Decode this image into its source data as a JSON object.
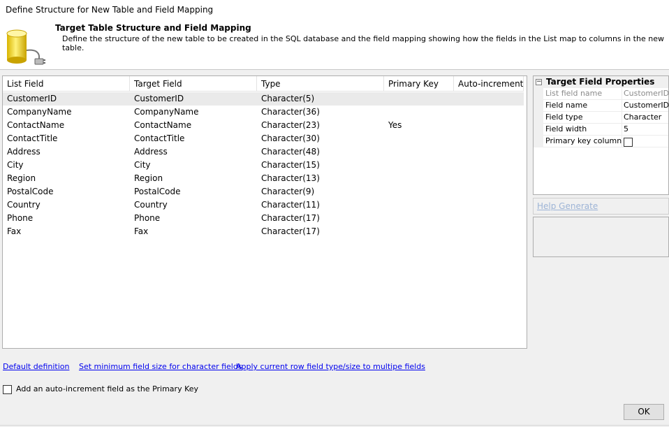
{
  "window": {
    "title": "Define Structure for New Table and Field Mapping"
  },
  "header": {
    "title": "Target Table Structure and Field Mapping",
    "description": "Define the structure of the new table to be created in the SQL database and the field mapping showing how the fields in the List map to columns in the new table."
  },
  "grid": {
    "columns": [
      "List Field",
      "Target Field",
      "Type",
      "Primary Key",
      "Auto-increment"
    ],
    "rows": [
      {
        "list_field": "CustomerID",
        "target_field": "CustomerID",
        "type": "Character(5)",
        "primary_key": "",
        "auto_increment": ""
      },
      {
        "list_field": "CompanyName",
        "target_field": "CompanyName",
        "type": "Character(36)",
        "primary_key": "",
        "auto_increment": ""
      },
      {
        "list_field": "ContactName",
        "target_field": "ContactName",
        "type": "Character(23)",
        "primary_key": "Yes",
        "auto_increment": ""
      },
      {
        "list_field": "ContactTitle",
        "target_field": "ContactTitle",
        "type": "Character(30)",
        "primary_key": "",
        "auto_increment": ""
      },
      {
        "list_field": "Address",
        "target_field": "Address",
        "type": "Character(48)",
        "primary_key": "",
        "auto_increment": ""
      },
      {
        "list_field": "City",
        "target_field": "City",
        "type": "Character(15)",
        "primary_key": "",
        "auto_increment": ""
      },
      {
        "list_field": "Region",
        "target_field": "Region",
        "type": "Character(13)",
        "primary_key": "",
        "auto_increment": ""
      },
      {
        "list_field": "PostalCode",
        "target_field": "PostalCode",
        "type": "Character(9)",
        "primary_key": "",
        "auto_increment": ""
      },
      {
        "list_field": "Country",
        "target_field": "Country",
        "type": "Character(11)",
        "primary_key": "",
        "auto_increment": ""
      },
      {
        "list_field": "Phone",
        "target_field": "Phone",
        "type": "Character(17)",
        "primary_key": "",
        "auto_increment": ""
      },
      {
        "list_field": "Fax",
        "target_field": "Fax",
        "type": "Character(17)",
        "primary_key": "",
        "auto_increment": ""
      }
    ]
  },
  "properties": {
    "category": "Target Field Properties",
    "collapse_glyph": "−",
    "items": [
      {
        "name": "List field name",
        "value": "CustomerID"
      },
      {
        "name": "Field name",
        "value": "CustomerID"
      },
      {
        "name": "Field type",
        "value": "Character"
      },
      {
        "name": "Field width",
        "value": "5"
      },
      {
        "name": "Primary key column",
        "value": ""
      }
    ]
  },
  "help": {
    "generate_label": "Help Generate"
  },
  "links": {
    "default_definition": "Default definition",
    "min_field_size": "Set minimum field size for character fields",
    "apply_current_row": "Apply current row field type/size to multipe fields"
  },
  "auto_increment_option": {
    "label": "Add an auto-increment field as the Primary Key"
  },
  "buttons": {
    "ok": "OK"
  },
  "icons": {
    "header_icon": "database-plug-icon"
  },
  "colors": {
    "selected_row": "#eaeaea",
    "link": "#0000ee",
    "disabled_link": "#9db4d6"
  }
}
